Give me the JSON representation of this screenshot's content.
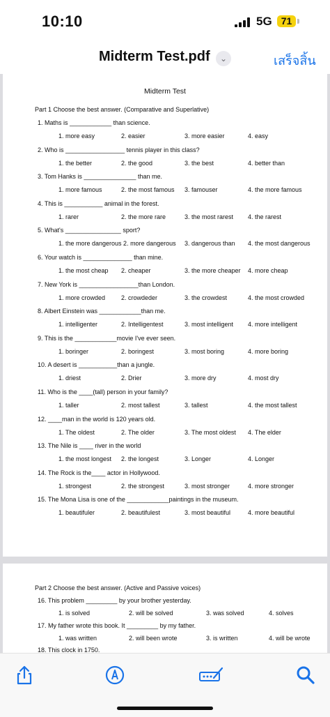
{
  "status_bar": {
    "time": "10:10",
    "network": "5G",
    "battery": "71"
  },
  "nav": {
    "title": "Midterm Test.pdf",
    "done_label": "เสร็จสิ้น"
  },
  "document": {
    "title": "Midterm Test",
    "part1_heading": "Part 1 Choose the best answer. (Comparative and Superlative)",
    "questions": [
      {
        "q": "1.   Maths is ____________ than science.",
        "options": [
          "1.  more easy",
          "2. easier",
          "3. more easier",
          "4. easy"
        ]
      },
      {
        "q": "2. Who is _________________ tennis player in this class?",
        "options": [
          "1. the better",
          "2. the good",
          "3. the best",
          "4. better than"
        ]
      },
      {
        "q": "3. Tom Hanks is _______________ than me.",
        "options": [
          "1. more famous",
          "2. the most famous",
          "3. famouser",
          "4. the more famous"
        ]
      },
      {
        "q": "4. This is ___________ animal in the forest.",
        "options": [
          "1. rarer",
          "2. the more rare",
          "3. the most rarest",
          "4. the rarest"
        ]
      },
      {
        "q": "5. What's ________________ sport?",
        "options": [
          "1. the more dangerous 2. more dangerous",
          "",
          "3. dangerous than",
          "4. the most dangerous"
        ]
      },
      {
        "q": "6. Your watch is ______________ than mine.",
        "options": [
          "1. the most cheap",
          "2. cheaper",
          "3. the more cheaper",
          "4. more cheap"
        ]
      },
      {
        "q": "7. New York is _________________than London.",
        "options": [
          "1. more crowded",
          "2. crowdeder",
          "3. the crowdest",
          "4. the most crowded"
        ]
      },
      {
        "q": "8. Albert Einstein was ____________than me.",
        "options": [
          "1. intelligenter",
          "2. Intelligentest",
          "3. most intelligent",
          "4. more intelligent"
        ]
      },
      {
        "q": "9. This is the ____________movie I've ever seen.",
        "options": [
          "1. boringer",
          "2. boringest",
          "3. most boring",
          "4. more boring"
        ]
      },
      {
        "q": "10. A desert is ___________than a jungle.",
        "options": [
          "1. driest",
          "2. Drier",
          "3. more dry",
          "4. most dry"
        ]
      },
      {
        "q": "11. Who is the ____(tall) person in your family?",
        "options": [
          "1. taller",
          "2. most tallest",
          "3. tallest",
          "4. the most tallest"
        ]
      },
      {
        "q": "12. ____man in the world is 120 years old.",
        "options": [
          "1. The oldest",
          "2. The older",
          "3. The most oldest",
          "4. The elder"
        ]
      },
      {
        "q": "13. The Nile is ____ river in the world",
        "options": [
          "1. the most longest",
          "2. the longest",
          "3. Longer",
          "4. Longer"
        ]
      },
      {
        "q": "14. The Rock is the____ actor in Hollywood.",
        "options": [
          "1. strongest",
          "2.  the strongest",
          "3. most stronger",
          "4. more stronger"
        ]
      },
      {
        "q": "15. The Mona Lisa is one of the ____________paintings in the museum.",
        "options": [
          "1. beautifuler",
          "2. beautifulest",
          "3. most beautiful",
          "4. more beautiful"
        ]
      }
    ],
    "part2_heading": "Part 2 Choose the best answer. (Active and Passive voices)",
    "part2_questions": [
      {
        "q": "16. This problem _________ by your brother yesterday.",
        "options": [
          "1. is solved",
          "2. will be solved",
          "3. was solved",
          "4. solves"
        ]
      },
      {
        "q": "17. My father wrote this book. It _________ by my father.",
        "options": [
          "1. was written",
          "2. will been wrote",
          "3. is written",
          "4. will be wrote"
        ]
      },
      {
        "q": "18. This clock              in 1750.",
        "options": []
      }
    ]
  },
  "toolbar": {
    "icons": [
      "share-icon",
      "markup-icon",
      "signature-icon",
      "search-icon"
    ]
  },
  "colors": {
    "accent": "#1a73e8",
    "battery": "#f5d20e",
    "viewer_bg": "#dcdce0"
  }
}
